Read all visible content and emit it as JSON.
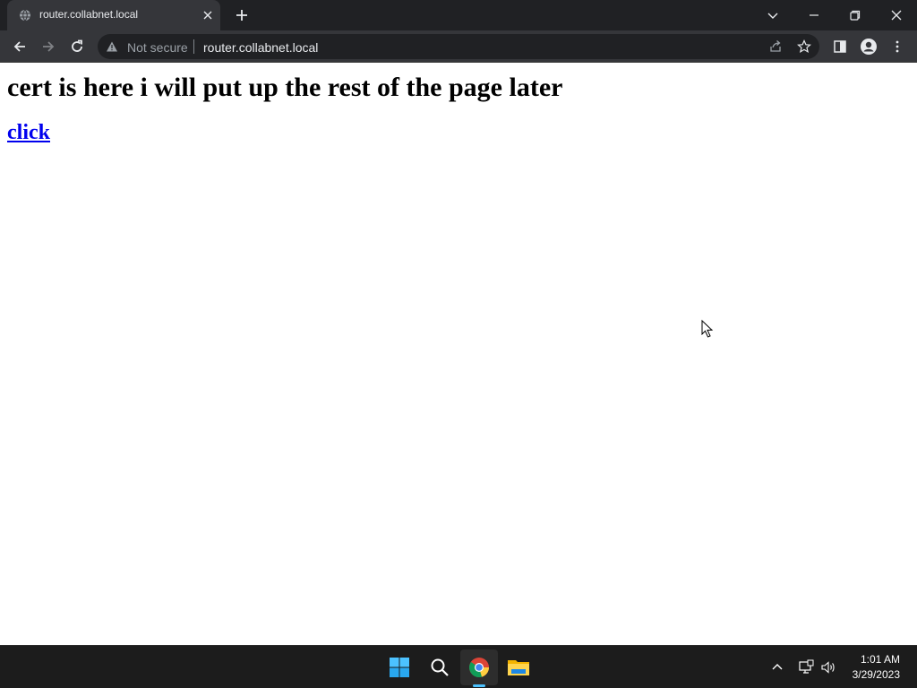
{
  "browser": {
    "tab": {
      "title": "router.collabnet.local",
      "favicon": "globe-icon"
    },
    "toolbar": {
      "security_label": "Not secure",
      "url": "router.collabnet.local"
    },
    "icons": {
      "back": "arrow-left-icon",
      "forward": "arrow-right-icon",
      "reload": "reload-icon",
      "share": "share-icon",
      "bookmark": "star-icon",
      "side_panel": "side-panel-icon",
      "profile": "profile-icon",
      "menu": "kebab-menu-icon"
    }
  },
  "page": {
    "heading": "cert is here i will put up the rest of the page later",
    "link_text": "click",
    "link_color": "#0000ee"
  },
  "taskbar": {
    "apps": [
      "windows-start-icon",
      "search-icon",
      "chrome-icon",
      "file-explorer-icon"
    ],
    "clock": {
      "time": "1:01 AM",
      "date": "3/29/2023"
    }
  },
  "colors": {
    "tabbar_bg": "#202124",
    "toolbar_bg": "#35363a",
    "omnibox_bg": "#202124",
    "taskbar_bg": "#1c1c1c",
    "accent": "#4cc2ff"
  }
}
